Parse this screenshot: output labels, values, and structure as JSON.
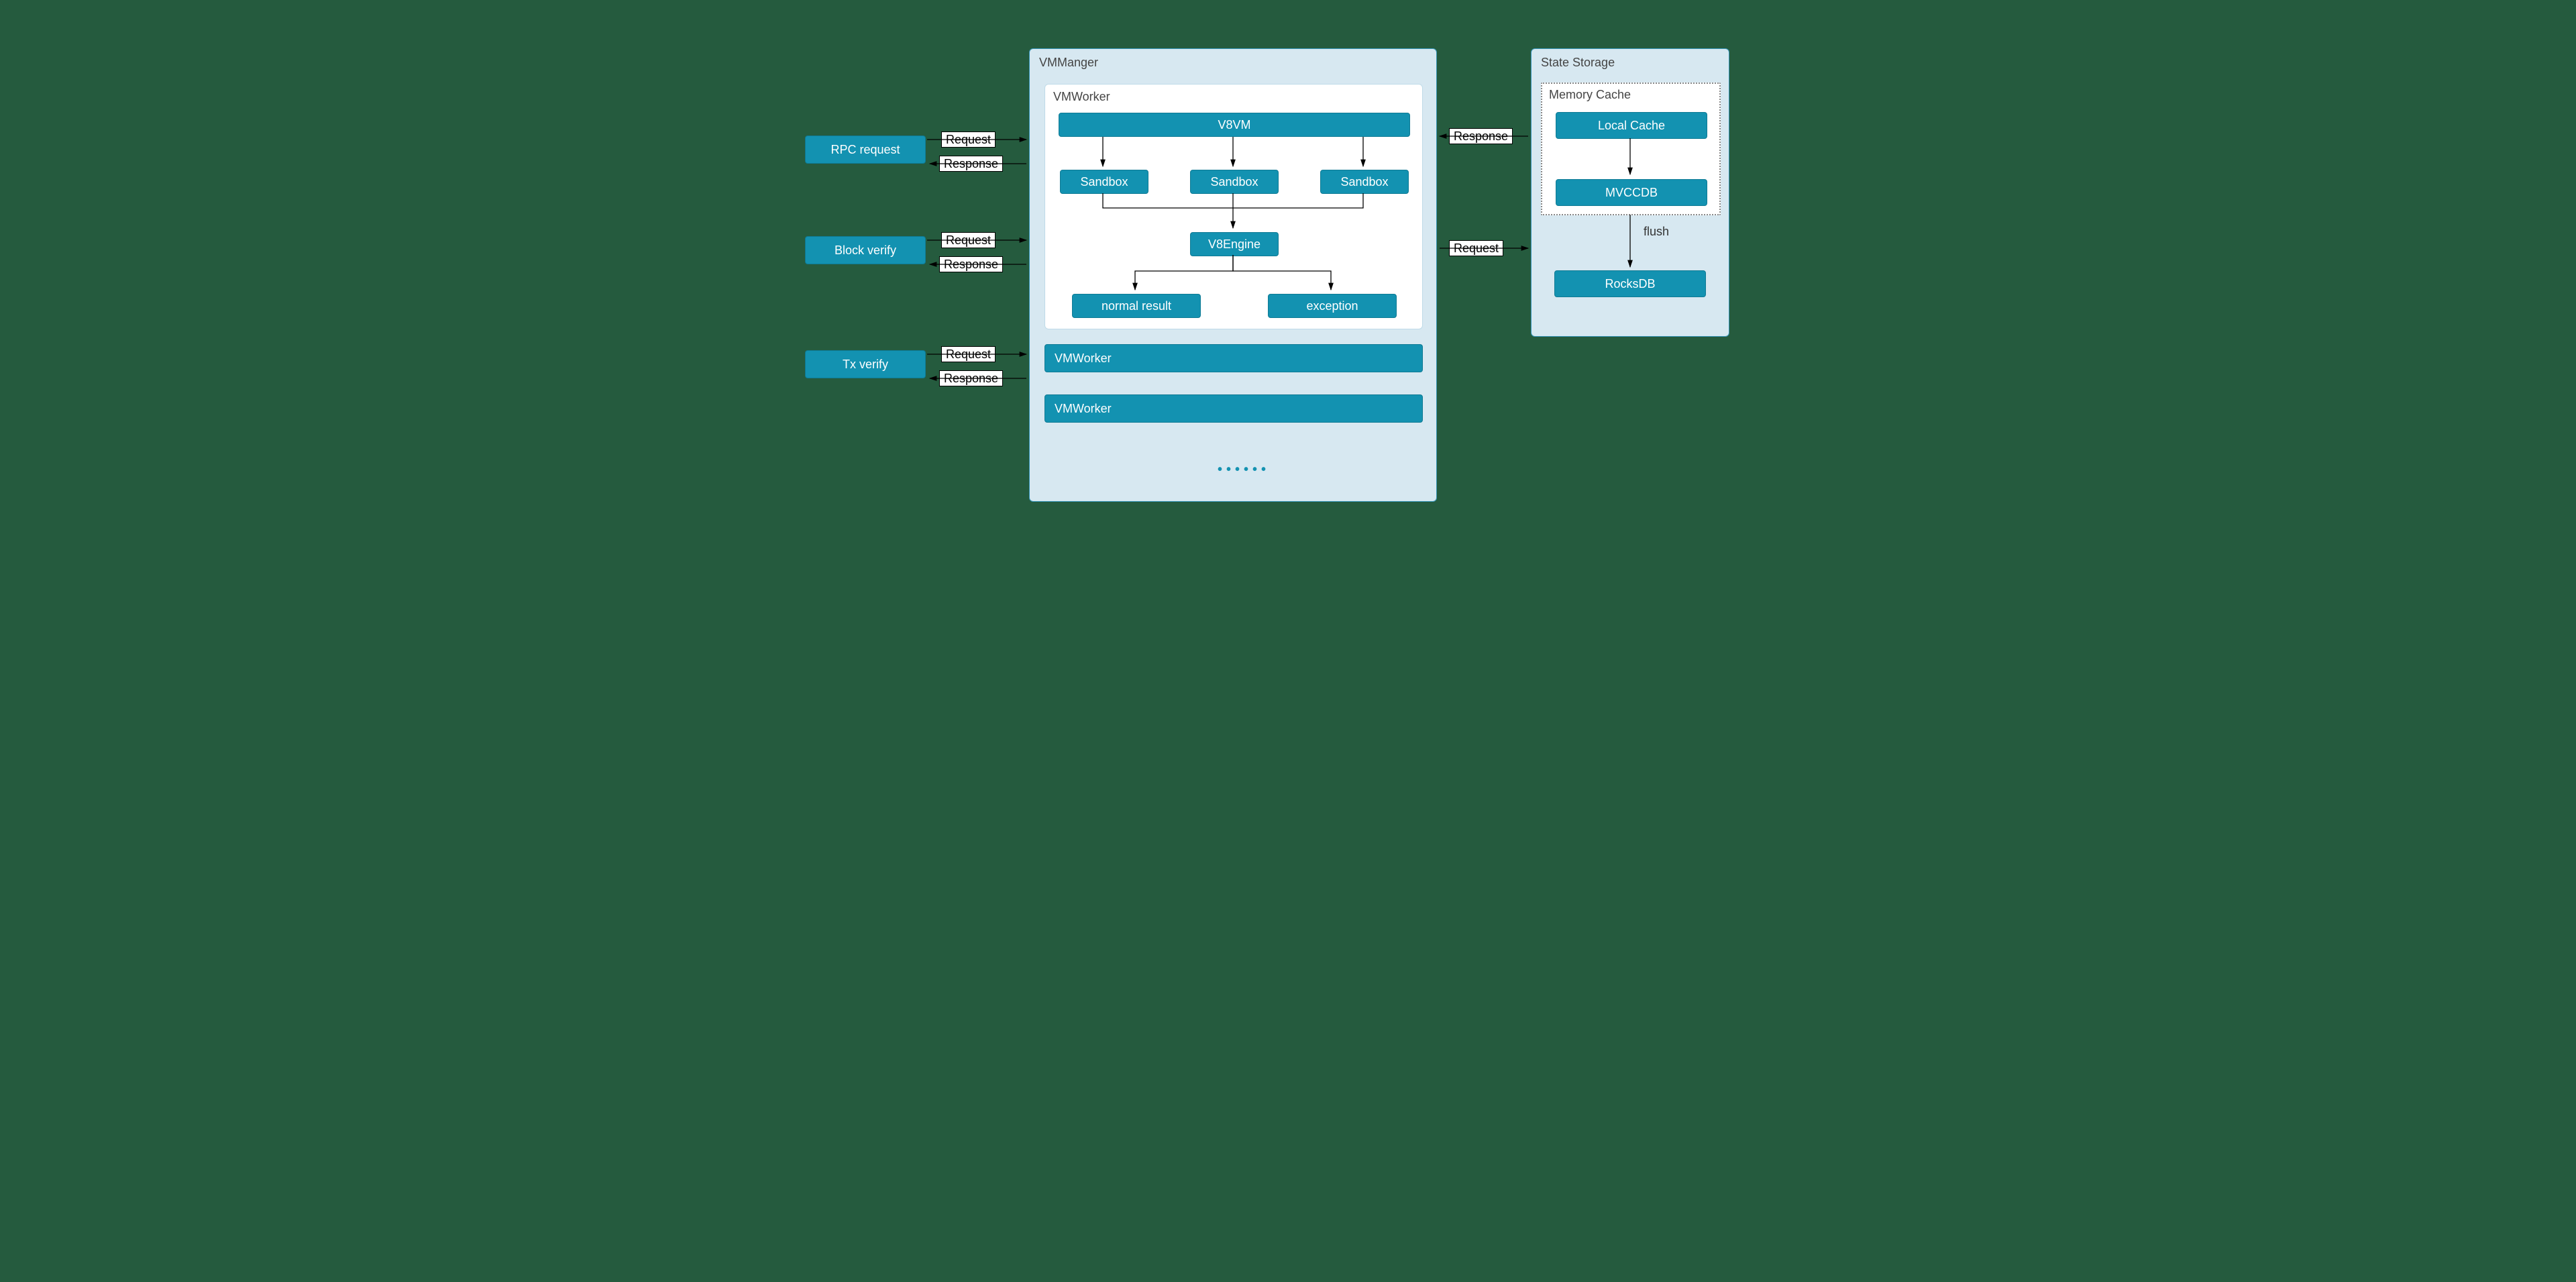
{
  "left_nodes": {
    "rpc": "RPC request",
    "block": "Block verify",
    "tx": "Tx verify"
  },
  "labels": {
    "request": "Request",
    "response": "Response",
    "flush": "flush"
  },
  "vmmanager": {
    "title": "VMManger",
    "worker_expanded_title": "VMWorker",
    "v8vm": "V8VM",
    "sandbox1": "Sandbox",
    "sandbox2": "Sandbox",
    "sandbox3": "Sandbox",
    "v8engine": "V8Engine",
    "normal_result": "normal result",
    "exception": "exception",
    "worker2": "VMWorker",
    "worker3": "VMWorker"
  },
  "state_storage": {
    "title": "State Storage",
    "memory_cache_title": "Memory Cache",
    "local_cache": "Local Cache",
    "mvccdb": "MVCCDB",
    "rocksdb": "RocksDB"
  }
}
